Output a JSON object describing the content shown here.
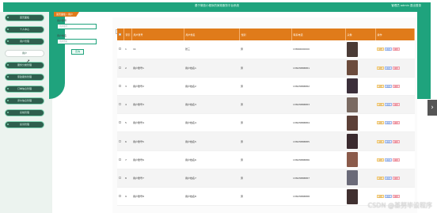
{
  "header": {
    "title": "基于微信小程序的家政服务平台系统",
    "user": "管理员 admin 退出登录"
  },
  "sidebar": {
    "items": [
      {
        "label": "首页面板"
      },
      {
        "label": "个人中心"
      },
      {
        "label": "用户管理"
      },
      {
        "label": "用户"
      },
      {
        "label": "服务分类管理"
      },
      {
        "label": "家政服务管理"
      },
      {
        "label": "订单信息管理"
      },
      {
        "label": "评价信息管理"
      },
      {
        "label": "系统管理"
      },
      {
        "label": "投诉管理"
      }
    ]
  },
  "breadcrumb": {
    "first": "首页面板",
    "second": "用户"
  },
  "search": {
    "label1": "用户账号",
    "placeholder1": "用户账号",
    "label2": "用户姓名",
    "placeholder2": "用户姓名",
    "button": "查询"
  },
  "toolbar": {
    "add": "新增",
    "delete": "删除"
  },
  "table": {
    "headers": [
      "",
      "索引",
      "用户账号",
      "用户姓名",
      "性别",
      "联系电话",
      "头像",
      "操作"
    ],
    "rows": [
      {
        "idx": "1",
        "account": "11",
        "name": "张三",
        "gender": "男",
        "phone": "13800000000"
      },
      {
        "idx": "2",
        "account": "用户账号1",
        "name": "用户姓名1",
        "gender": "男",
        "phone": "13823888881"
      },
      {
        "idx": "3",
        "account": "用户账号2",
        "name": "用户姓名2",
        "gender": "男",
        "phone": "13823888882"
      },
      {
        "idx": "4",
        "account": "用户账号3",
        "name": "用户姓名3",
        "gender": "男",
        "phone": "13823888883"
      },
      {
        "idx": "5",
        "account": "用户账号4",
        "name": "用户姓名4",
        "gender": "男",
        "phone": "13823888884"
      },
      {
        "idx": "6",
        "account": "用户账号5",
        "name": "用户姓名5",
        "gender": "男",
        "phone": "13823888885"
      },
      {
        "idx": "7",
        "account": "用户账号6",
        "name": "用户姓名6",
        "gender": "男",
        "phone": "13823888886"
      },
      {
        "idx": "8",
        "account": "用户账号7",
        "name": "用户姓名7",
        "gender": "男",
        "phone": "13823888887"
      },
      {
        "idx": "9",
        "account": "用户账号8",
        "name": "用户姓名8",
        "gender": "男",
        "phone": "13823888888"
      }
    ],
    "actions": {
      "edit": "详情",
      "view": "修改",
      "rm": "删除"
    }
  },
  "watermark": "CSDN @基努毕设程序",
  "colors": {
    "accent": "#1fa37d",
    "header": "#e07b1a"
  }
}
